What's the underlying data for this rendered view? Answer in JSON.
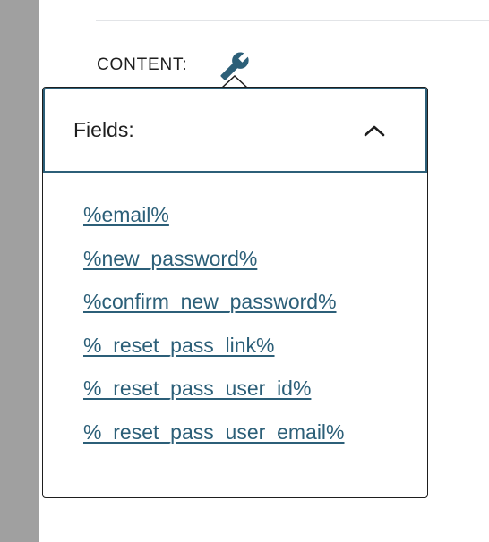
{
  "content_label": "CONTENT:",
  "toolbar": {
    "wrench_icon": "wrench-icon"
  },
  "panel": {
    "title": "Fields:",
    "expanded": true,
    "toggle_icon": "chevron-up-icon"
  },
  "fields": [
    "%email%",
    "%new_password%",
    "%confirm_new_password%",
    "%_reset_pass_link%",
    "%_reset_pass_user_id%",
    "%_reset_pass_user_email%"
  ],
  "colors": {
    "link": "#2c5f78",
    "header_border": "#2c5f78",
    "wrench": "#2c5f78",
    "text": "#1e1e1e",
    "left_strip": "#a0a0a0"
  }
}
